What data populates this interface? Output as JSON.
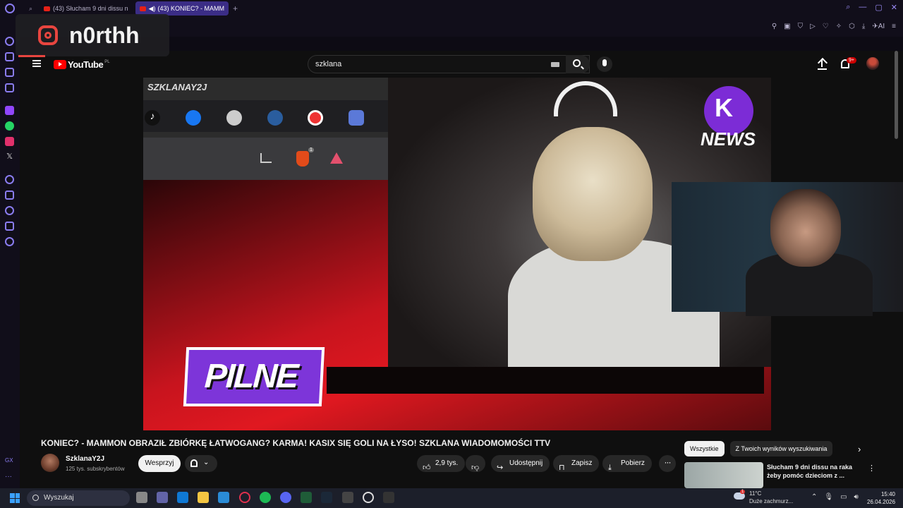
{
  "browser": {
    "tabs": [
      {
        "label": "(43) Słucham 9 dni dissu n",
        "active": false
      },
      {
        "label": "(43) KONIEC? - MAMM",
        "active": true
      }
    ],
    "new_tab": "+",
    "toolbar_ai": "AI"
  },
  "overlay": {
    "instagram_handle": "n0rthh"
  },
  "youtube": {
    "logo_text": "YouTube",
    "logo_region": "PL",
    "search_query": "szklana",
    "notification_count": "9+",
    "video": {
      "corner_label": "SZKLANAY2J",
      "news_logo_text": "NEWS",
      "pilne_text": "PILNE",
      "brave_badge": "1"
    },
    "title": "KONIEC? - MAMMON OBRAZIŁ ZBIÓRKĘ ŁATWOGANG? KARMA! KASIX SIĘ GOLI NA ŁYSO! SZKLANA WIADOMOMOŚCI TTV",
    "channel": {
      "name": "SzklanaY2J",
      "subscribers": "125 tys. subskrybentów",
      "support_label": "Wesprzyj"
    },
    "actions": {
      "likes": "2,9 tys.",
      "share": "Udostępnij",
      "save": "Zapisz",
      "download": "Pobierz"
    },
    "chips": [
      "Wszystkie",
      "Z Twoich wyników wyszukiwania"
    ],
    "recommendation": {
      "title": "Słucham 9 dni dissu na raka żeby pomóc dzieciom z ..."
    }
  },
  "taskbar": {
    "search_placeholder": "Wyszukaj",
    "weather_temp": "11°C",
    "weather_desc": "Duże zachmurz...",
    "weather_badge": "1",
    "time": "15:40",
    "date": "26.04.2026"
  },
  "colors": {
    "accent": "#3b2d86",
    "youtube_red": "#ff0000",
    "pilne_purple": "#7d35d9"
  }
}
